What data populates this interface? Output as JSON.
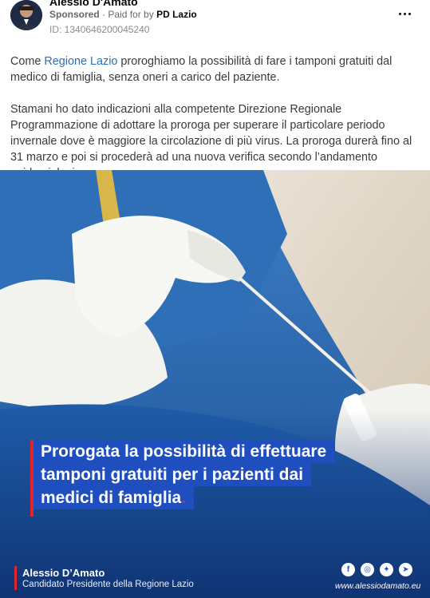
{
  "post": {
    "author": "Alessio D'Amato",
    "sponsored_label": "Sponsored",
    "separator": "·",
    "paid_for_prefix": "Paid for by",
    "paid_for_by": "PD Lazio",
    "ad_id": "ID: 1340646200045240",
    "paragraph1": {
      "before_link": "Come ",
      "link_text": "Regione Lazio",
      "after_link": " proroghiamo la possibilità di fare i tamponi gratuiti dal medico di famiglia, senza oneri a carico del paziente."
    },
    "paragraph2": "Stamani ho dato indicazioni alla competente Direzione Regionale Programmazione di adottare la proroga per superare il particolare periodo invernale dove è maggiore la circolazione di più virus. La proroga durerà fino al 31 marzo e poi si procederà ad una nuova verifica secondo l’andamento epidemiologico."
  },
  "creative": {
    "headline_lines": [
      "Prorogata la possibilità di effettuare",
      "tamponi gratuiti per i pazienti dai",
      "medici di famiglia"
    ],
    "headline_end_dot": ".",
    "footer_name": "Alessio D’Amato",
    "footer_role": "Candidato Presidente della Regione Lazio",
    "website": "www.alessiodamato.eu",
    "social_icons": [
      "facebook-icon",
      "instagram-icon",
      "twitter-icon",
      "telegram-icon"
    ],
    "colors": {
      "headline_bg": "#1f4fbf",
      "accent_red": "#e3242b",
      "link": "#2d6fb5"
    }
  }
}
